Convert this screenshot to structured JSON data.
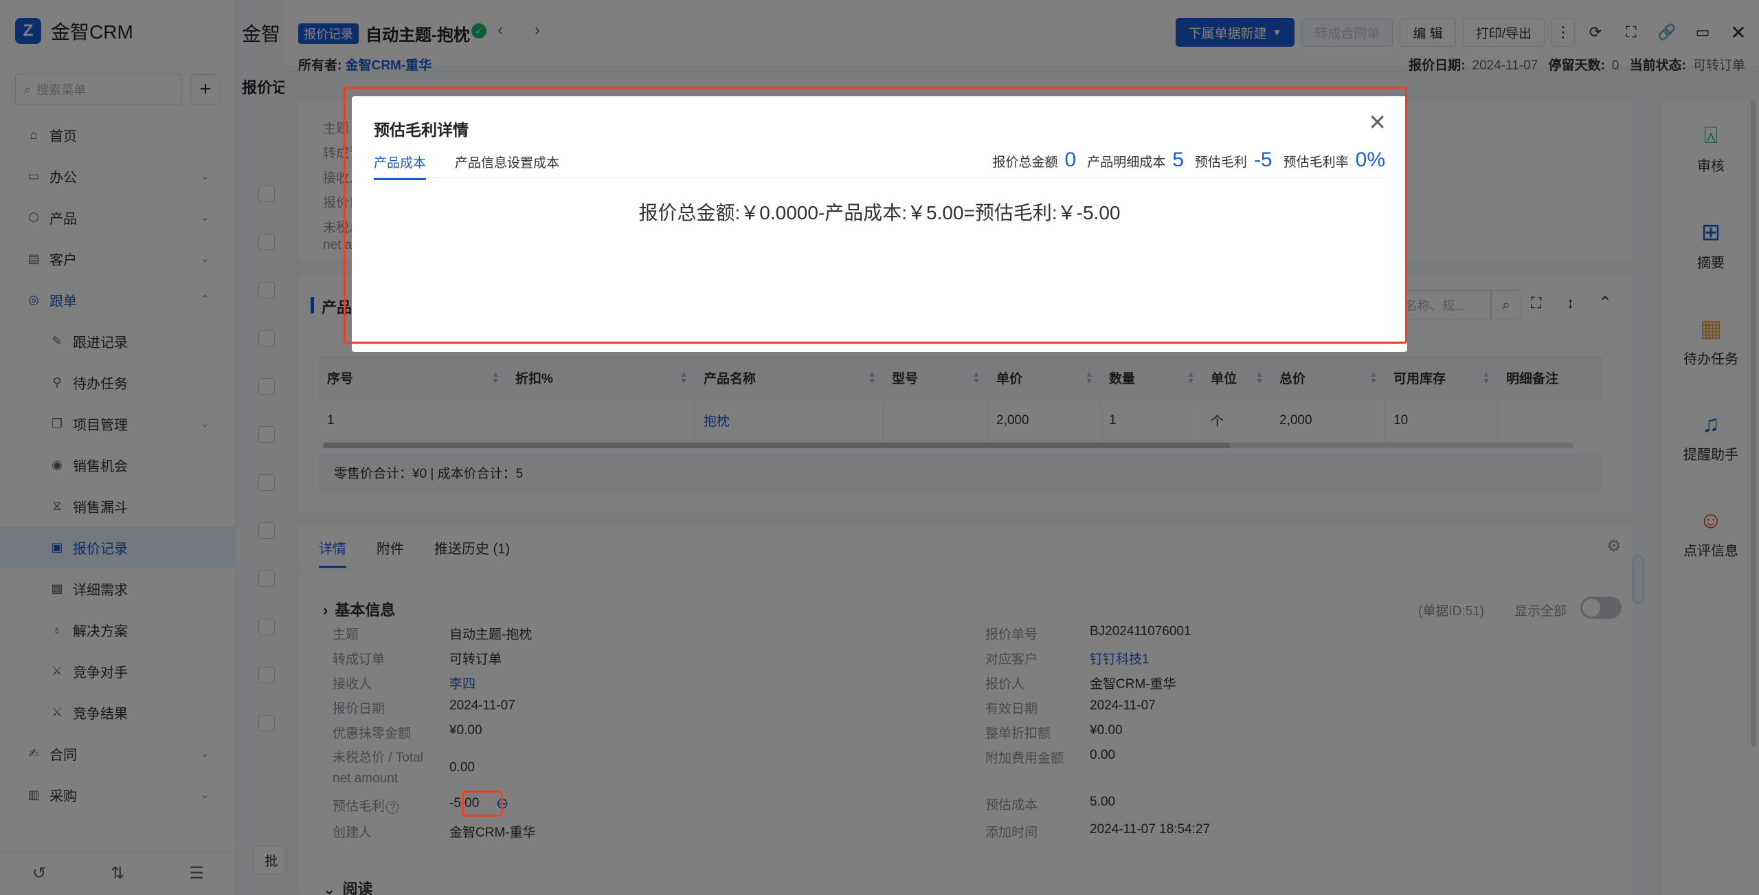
{
  "app": {
    "logo_letter": "Z",
    "name": "金智CRM",
    "search_placeholder": "搜索菜单"
  },
  "sidebar": {
    "items": [
      {
        "label": "首页",
        "icon": "home-icon"
      },
      {
        "label": "办公",
        "icon": "office-icon"
      },
      {
        "label": "产品",
        "icon": "box-icon"
      },
      {
        "label": "客户",
        "icon": "customer-icon"
      },
      {
        "label": "跟单",
        "icon": "target-icon"
      },
      {
        "label": "跟进记录",
        "icon": "note-icon"
      },
      {
        "label": "待办任务",
        "icon": "pin-icon"
      },
      {
        "label": "项目管理",
        "icon": "project-icon"
      },
      {
        "label": "销售机会",
        "icon": "opportunity-icon"
      },
      {
        "label": "销售漏斗",
        "icon": "funnel-icon"
      },
      {
        "label": "报价记录",
        "icon": "quote-icon"
      },
      {
        "label": "详细需求",
        "icon": "doc-icon"
      },
      {
        "label": "解决方案",
        "icon": "bulb-icon"
      },
      {
        "label": "竞争对手",
        "icon": "rival-icon"
      },
      {
        "label": "竞争结果",
        "icon": "result-icon"
      },
      {
        "label": "合同",
        "icon": "contract-icon"
      },
      {
        "label": "采购",
        "icon": "purchase-icon"
      }
    ]
  },
  "list": {
    "title": "金智",
    "subtitle": "报价记",
    "batch": "批"
  },
  "header": {
    "tag": "报价记录",
    "title": "自动主题-抱枕",
    "owner_label": "所有者:",
    "owner_value": "金智CRM-重华",
    "btn_new": "下属单据新建",
    "btn_convert": "转成合同单",
    "btn_edit": "编 辑",
    "btn_print": "打印/导出",
    "date_label": "报价日期:",
    "date_value": "2024-11-07",
    "stay_label": "停留天数:",
    "stay_value": "0",
    "status_label": "当前状态:",
    "status_value": "可转订单"
  },
  "bg_summary": {
    "lines": [
      "主题",
      "转成订",
      "接收人",
      "报价日",
      "未税总",
      "net am"
    ]
  },
  "products": {
    "section_label": "产品",
    "search_placeholder": "名称、规...",
    "columns": [
      "序号",
      "折扣%",
      "产品名称",
      "型号",
      "单价",
      "数量",
      "单位",
      "总价",
      "可用库存",
      "明细备注"
    ],
    "rows": [
      [
        "1",
        "",
        "抱枕",
        "",
        "2,000",
        "1",
        "个",
        "2,000",
        "10",
        ""
      ]
    ],
    "footer": "零售价合计：¥0 |   成本价合计：5"
  },
  "detail": {
    "tabs": [
      "详情",
      "附件",
      "推送历史 (1)"
    ],
    "section": "基本信息",
    "doc_id": "(单据ID:51)",
    "show_all": "显示全部",
    "left": [
      {
        "k": "主题",
        "v": "自动主题-抱枕"
      },
      {
        "k": "转成订单",
        "v": "可转订单"
      },
      {
        "k": "接收人",
        "v": "李四"
      },
      {
        "k": "报价日期",
        "v": "2024-11-07"
      },
      {
        "k": "优惠抹零金额",
        "v": "¥0.00"
      },
      {
        "k": "未税总价 / Total net amount",
        "v": "0.00"
      },
      {
        "k": "预估毛利",
        "v": "-5.00"
      },
      {
        "k": "创建人",
        "v": "金智CRM-重华"
      }
    ],
    "right": [
      {
        "k": "报价单号",
        "v": "BJ202411076001"
      },
      {
        "k": "对应客户",
        "v": "钉钉科技1"
      },
      {
        "k": "报价人",
        "v": "金智CRM-重华"
      },
      {
        "k": "有效日期",
        "v": "2024-11-07"
      },
      {
        "k": "整单折扣额",
        "v": "¥0.00"
      },
      {
        "k": "附加费用金额",
        "v": "0.00"
      },
      {
        "k": "预估成本",
        "v": "5.00"
      },
      {
        "k": "添加时间",
        "v": "2024-11-07 18:54:27"
      }
    ],
    "next_section": "阅读"
  },
  "right_bar": [
    {
      "label": "审核",
      "icon": "stamp-icon",
      "color": "#19be6b"
    },
    {
      "label": "摘要",
      "icon": "grid-search-icon",
      "color": "#1d5cd6"
    },
    {
      "label": "待办任务",
      "icon": "calendar-clock-icon",
      "color": "#e6a23c"
    },
    {
      "label": "提醒助手",
      "icon": "bell-icon",
      "color": "#1d5cd6"
    },
    {
      "label": "点评信息",
      "icon": "comment-icon",
      "color": "#e8412c"
    }
  ],
  "modal": {
    "title": "预估毛利详情",
    "tabs": [
      "产品成本",
      "产品信息设置成本"
    ],
    "sum_total_label": "报价总金额",
    "sum_total_value": "0",
    "sum_cost_label": "产品明细成本",
    "sum_cost_value": "5",
    "sum_profit_label": "预估毛利",
    "sum_profit_value": "-5",
    "sum_rate_label": "预估毛利率",
    "sum_rate_value": "0%",
    "formula": "报价总金额:￥0.0000-产品成本:￥5.00=预估毛利:￥-5.00"
  },
  "colors": {
    "accent": "#1d5cd6",
    "highlight": "#e8412c"
  }
}
